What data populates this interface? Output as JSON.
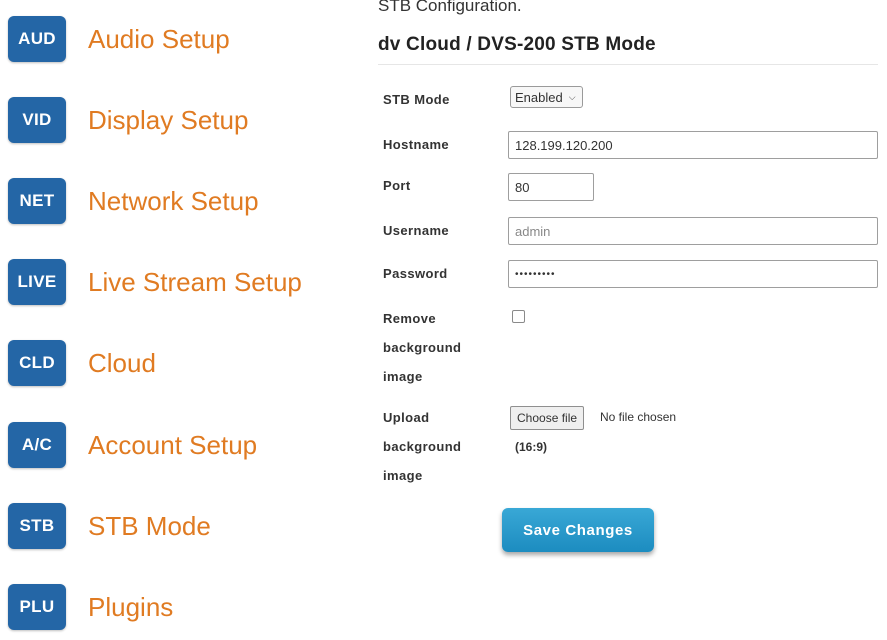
{
  "sidebar": {
    "items": [
      {
        "badge": "AUD",
        "label": "Audio Setup"
      },
      {
        "badge": "VID",
        "label": "Display Setup"
      },
      {
        "badge": "NET",
        "label": "Network Setup"
      },
      {
        "badge": "LIVE",
        "label": "Live Stream Setup"
      },
      {
        "badge": "CLD",
        "label": "Cloud"
      },
      {
        "badge": "A/C",
        "label": "Account Setup"
      },
      {
        "badge": "STB",
        "label": "STB Mode"
      },
      {
        "badge": "PLU",
        "label": "Plugins"
      }
    ]
  },
  "main": {
    "breadcrumb": "STB Configuration.",
    "title": "dv Cloud / DVS-200 STB Mode",
    "form": {
      "stb_mode": {
        "label": "STB Mode",
        "value": "Enabled"
      },
      "hostname": {
        "label": "Hostname",
        "value": "128.199.120.200"
      },
      "port": {
        "label": "Port",
        "value": "80"
      },
      "username": {
        "label": "Username",
        "placeholder": "admin"
      },
      "password": {
        "label": "Password",
        "value": "•••••••••"
      },
      "remove_bg": {
        "label_line1": "Remove",
        "label_line2": "background",
        "label_line3": "image"
      },
      "upload_bg": {
        "label_line1": "Upload",
        "label_line2": "background",
        "label_line3": "image",
        "button": "Choose file",
        "status": "No file chosen",
        "ratio": "(16:9)"
      }
    },
    "save_label": "Save Changes"
  }
}
